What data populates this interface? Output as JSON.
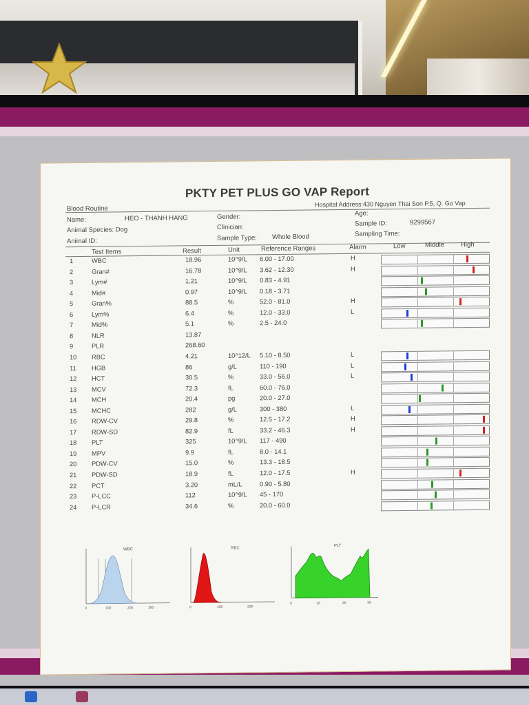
{
  "report": {
    "title": "PKTY PET PLUS GO VAP Report",
    "hospital_address": "Hospital Address:430 Nguyen Thai Son P.5, Q. Go Vap",
    "section": "Blood Routine",
    "name_label": "Name:",
    "name_value": "HEO - THANH HANG",
    "species_label": "Animal Species: Dog",
    "animal_id_label": "Animal ID:",
    "gender_label": "Gender:",
    "clinician_label": "Clinician:",
    "sample_type_label": "Sample Type:",
    "sample_type_value": "Whole Blood",
    "age_label": "Age:",
    "sample_id_label": "Sample ID:",
    "sample_id_value": "9299567",
    "sampling_time_label": "Sampling Time:",
    "headers": {
      "test_items": "Test Items",
      "result": "Result",
      "unit": "Unit",
      "reference": "Reference Ranges",
      "alarm": "Alarm",
      "low": "Low",
      "middle": "Middle",
      "high": "High"
    },
    "rows": [
      {
        "no": "1",
        "item": "WBC",
        "result": "18.96",
        "unit": "10^9/L",
        "ref": "6.00 - 17.00",
        "alarm": "H",
        "level": 0.82,
        "color": "#d62020"
      },
      {
        "no": "2",
        "item": "Gran#",
        "result": "16.78",
        "unit": "10^9/L",
        "ref": "3.62 - 12.30",
        "alarm": "H",
        "level": 0.88,
        "color": "#d62020"
      },
      {
        "no": "3",
        "item": "Lym#",
        "result": "1.21",
        "unit": "10^9/L",
        "ref": "0.83 - 4.91",
        "alarm": "",
        "level": 0.38,
        "color": "#2a9a2a"
      },
      {
        "no": "4",
        "item": "Mid#",
        "result": "0.97",
        "unit": "10^9/L",
        "ref": "0.18 - 3.71",
        "alarm": "",
        "level": 0.42,
        "color": "#2a9a2a"
      },
      {
        "no": "5",
        "item": "Gran%",
        "result": "88.5",
        "unit": "%",
        "ref": "52.0 - 81.0",
        "alarm": "H",
        "level": 0.75,
        "color": "#d62020"
      },
      {
        "no": "6",
        "item": "Lym%",
        "result": "6.4",
        "unit": "%",
        "ref": "12.0 - 33.0",
        "alarm": "L",
        "level": 0.24,
        "color": "#1f3fd6"
      },
      {
        "no": "7",
        "item": "Mid%",
        "result": "5.1",
        "unit": "%",
        "ref": "2.5 - 24.0",
        "alarm": "",
        "level": 0.38,
        "color": "#2a9a2a"
      },
      {
        "no": "8",
        "item": "NLR",
        "result": "13.87",
        "unit": "",
        "ref": "",
        "alarm": "",
        "level": null,
        "color": ""
      },
      {
        "no": "9",
        "item": "PLR",
        "result": "268.60",
        "unit": "",
        "ref": "",
        "alarm": "",
        "level": null,
        "color": ""
      },
      {
        "no": "10",
        "item": "RBC",
        "result": "4.21",
        "unit": "10^12/L",
        "ref": "5.10 - 8.50",
        "alarm": "L",
        "level": 0.24,
        "color": "#1f3fd6"
      },
      {
        "no": "11",
        "item": "HGB",
        "result": "86",
        "unit": "g/L",
        "ref": "110 - 190",
        "alarm": "L",
        "level": 0.22,
        "color": "#1f3fd6"
      },
      {
        "no": "12",
        "item": "HCT",
        "result": "30.5",
        "unit": "%",
        "ref": "33.0 - 56.0",
        "alarm": "L",
        "level": 0.28,
        "color": "#1f3fd6"
      },
      {
        "no": "13",
        "item": "MCV",
        "result": "72.3",
        "unit": "fL",
        "ref": "60.0 - 76.0",
        "alarm": "",
        "level": 0.58,
        "color": "#2a9a2a"
      },
      {
        "no": "14",
        "item": "MCH",
        "result": "20.4",
        "unit": "pg",
        "ref": "20.0 - 27.0",
        "alarm": "",
        "level": 0.36,
        "color": "#2a9a2a"
      },
      {
        "no": "15",
        "item": "MCHC",
        "result": "282",
        "unit": "g/L",
        "ref": "300 - 380",
        "alarm": "L",
        "level": 0.26,
        "color": "#1f3fd6"
      },
      {
        "no": "16",
        "item": "RDW-CV",
        "result": "29.8",
        "unit": "%",
        "ref": "12.5 - 17.2",
        "alarm": "H",
        "level": 0.98,
        "color": "#d62020"
      },
      {
        "no": "17",
        "item": "RDW-SD",
        "result": "82.9",
        "unit": "fL",
        "ref": "33.2 - 46.3",
        "alarm": "H",
        "level": 0.98,
        "color": "#d62020"
      },
      {
        "no": "18",
        "item": "PLT",
        "result": "325",
        "unit": "10^9/L",
        "ref": "117 - 490",
        "alarm": "",
        "level": 0.52,
        "color": "#2a9a2a"
      },
      {
        "no": "19",
        "item": "MPV",
        "result": "9.9",
        "unit": "fL",
        "ref": "8.0 - 14.1",
        "alarm": "",
        "level": 0.43,
        "color": "#2a9a2a"
      },
      {
        "no": "20",
        "item": "PDW-CV",
        "result": "15.0",
        "unit": "%",
        "ref": "13.3 - 18.5",
        "alarm": "",
        "level": 0.43,
        "color": "#2a9a2a"
      },
      {
        "no": "21",
        "item": "PDW-SD",
        "result": "18.9",
        "unit": "fL",
        "ref": "12.0 - 17.5",
        "alarm": "H",
        "level": 0.75,
        "color": "#d62020"
      },
      {
        "no": "22",
        "item": "PCT",
        "result": "3.20",
        "unit": "mL/L",
        "ref": "0.90 - 5.80",
        "alarm": "",
        "level": 0.48,
        "color": "#2a9a2a"
      },
      {
        "no": "23",
        "item": "P-LCC",
        "result": "112",
        "unit": "10^9/L",
        "ref": "45 - 170",
        "alarm": "",
        "level": 0.51,
        "color": "#2a9a2a"
      },
      {
        "no": "24",
        "item": "P-LCR",
        "result": "34.6",
        "unit": "%",
        "ref": "20.0 - 60.0",
        "alarm": "",
        "level": 0.47,
        "color": "#2a9a2a"
      }
    ],
    "histograms": [
      {
        "label": "WBC",
        "color": "#b9d4ec",
        "ticks": [
          "0",
          "100",
          "200",
          "300"
        ]
      },
      {
        "label": "RBC",
        "color": "#e01616",
        "ticks": [
          "0",
          "100",
          "200"
        ]
      },
      {
        "label": "PLT",
        "color": "#37d22a",
        "ticks": [
          "0",
          "10",
          "20",
          "30"
        ]
      }
    ]
  }
}
